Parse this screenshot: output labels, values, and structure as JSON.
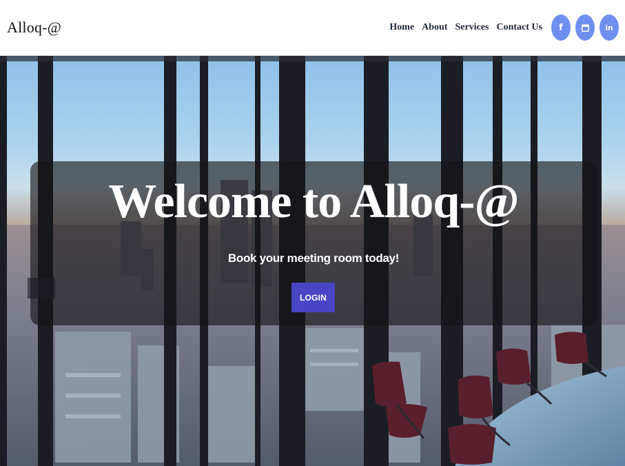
{
  "brand": {
    "name": "Alloq-@"
  },
  "nav": {
    "items": [
      {
        "label": "Home"
      },
      {
        "label": "About"
      },
      {
        "label": "Services"
      },
      {
        "label": "Contact Us"
      }
    ]
  },
  "social": [
    {
      "icon": "facebook-icon",
      "glyph": "f"
    },
    {
      "icon": "calendar-icon",
      "glyph": ""
    },
    {
      "icon": "linkedin-icon",
      "glyph": "in"
    }
  ],
  "hero": {
    "title": "Welcome to Alloq-@",
    "subtitle": "Book your meeting room today!",
    "login_label": "LOGIN"
  },
  "colors": {
    "accent": "#6f8ff0",
    "button": "#4a45c4",
    "overlay": "#141416"
  }
}
